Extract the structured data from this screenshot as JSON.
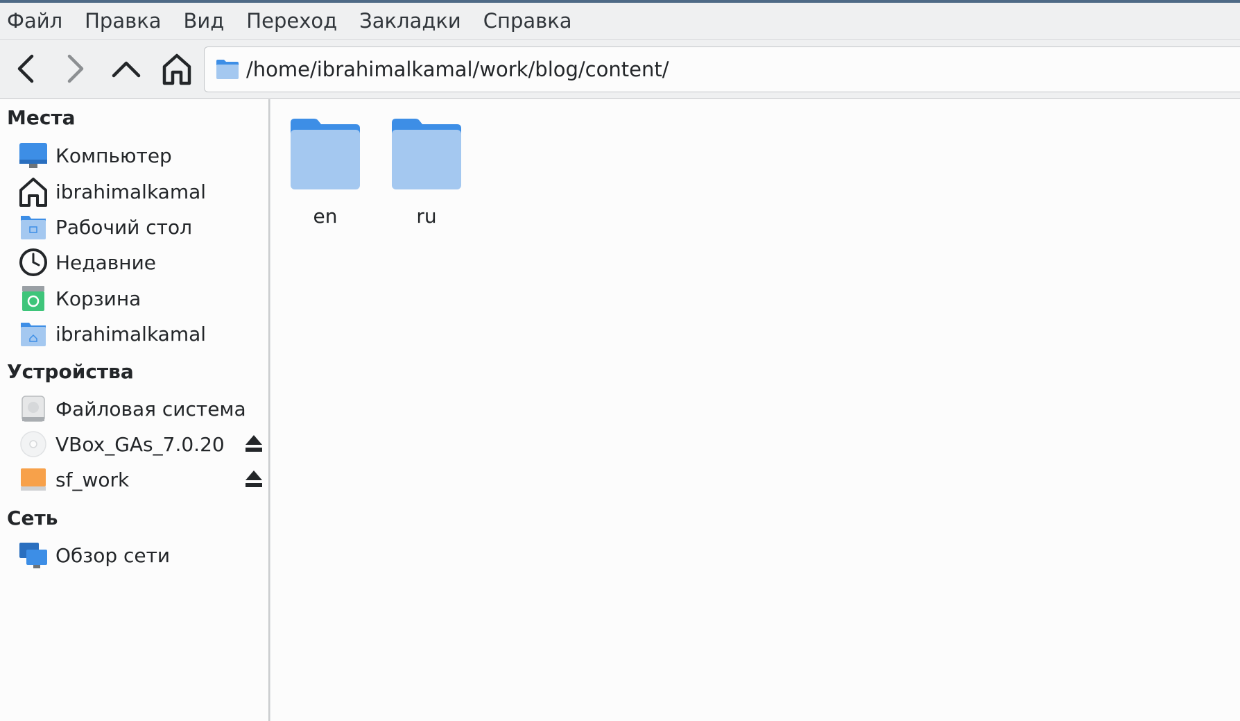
{
  "menubar": {
    "items": [
      "Файл",
      "Правка",
      "Вид",
      "Переход",
      "Закладки",
      "Справка"
    ]
  },
  "toolbar": {
    "back_icon": "chevron-left-icon",
    "forward_icon": "chevron-right-icon",
    "up_icon": "chevron-up-icon",
    "home_icon": "home-icon",
    "path": "/home/ibrahimalkamal/work/blog/content/"
  },
  "sidebar": {
    "places_title": "Места",
    "places": [
      {
        "label": "Компьютер",
        "icon": "computer-icon"
      },
      {
        "label": "ibrahimalkamal",
        "icon": "home-icon"
      },
      {
        "label": "Рабочий стол",
        "icon": "desktop-folder-icon"
      },
      {
        "label": "Недавние",
        "icon": "clock-icon"
      },
      {
        "label": "Корзина",
        "icon": "trash-icon"
      },
      {
        "label": "ibrahimalkamal",
        "icon": "home-folder-icon"
      }
    ],
    "devices_title": "Устройства",
    "devices": [
      {
        "label": "Файловая система",
        "icon": "drive-icon"
      },
      {
        "label": "VBox_GAs_7.0.20",
        "icon": "optical-disc-icon"
      },
      {
        "label": "sf_work",
        "icon": "removable-drive-icon"
      }
    ],
    "network_title": "Сеть",
    "network": [
      {
        "label": "Обзор сети",
        "icon": "network-icon"
      }
    ]
  },
  "content": {
    "folders": [
      {
        "name": "en",
        "icon": "folder-icon"
      },
      {
        "name": "ru",
        "icon": "folder-icon"
      }
    ]
  },
  "colors": {
    "folder_light": "#a4c8f0",
    "folder_dark": "#3d8ee6",
    "accent_line": "#4e6a86"
  }
}
